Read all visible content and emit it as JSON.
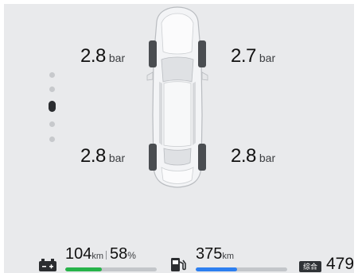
{
  "tires": {
    "front_left": {
      "value": "2.8",
      "unit": "bar"
    },
    "front_right": {
      "value": "2.7",
      "unit": "bar"
    },
    "rear_left": {
      "value": "2.8",
      "unit": "bar"
    },
    "rear_right": {
      "value": "2.8",
      "unit": "bar"
    }
  },
  "pager": {
    "count": 5,
    "active_index": 2
  },
  "battery": {
    "range": "104",
    "range_unit": "km",
    "percent": "58",
    "percent_unit": "%",
    "level": 0.4,
    "bar_color": "#27b34a"
  },
  "fuel": {
    "range": "375",
    "range_unit": "km",
    "level": 0.45,
    "bar_color": "#2d7ff0"
  },
  "combined": {
    "badge": "综合",
    "value": "479"
  }
}
